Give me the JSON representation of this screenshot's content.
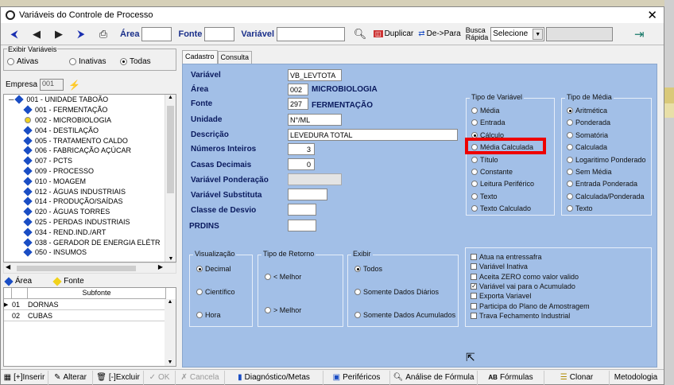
{
  "window": {
    "title": "Variáveis do Controle de Processo"
  },
  "toolbar": {
    "area_label": "Área",
    "fonte_label": "Fonte",
    "variavel_label": "Variável",
    "duplicar_label": "Duplicar",
    "de_para_label": "De->Para",
    "busca_label_1": "Busca",
    "busca_label_2": "Rápida",
    "busca_select": "Selecione"
  },
  "filter": {
    "legend": "Exibir Variáveis",
    "ativas": "Ativas",
    "inativas": "Inativas",
    "todas": "Todas",
    "selected": "Todas"
  },
  "empresa": {
    "label": "Empresa",
    "value": "001"
  },
  "tree": {
    "root": "001 - UNIDADE TABOÃO",
    "items": [
      "001 - FERMENTAÇÃO",
      "002 - MICROBIOLOGIA",
      "004 - DESTILAÇÃO",
      "005 - TRATAMENTO CALDO",
      "006 - FABRICAÇÃO AÇÚCAR",
      "007 - PCTS",
      "009 - PROCESSO",
      "010 - MOAGEM",
      "012 - ÁGUAS INDUSTRIAIS",
      "014 - PRODUÇÃO/SAÍDAS",
      "020 - ÁGUAS TORRES",
      "025 - PERDAS INDUSTRIAIS",
      "034 - REND.IND./ART",
      "038 - GERADOR DE ENERGIA ELÉTR",
      "050 - INSUMOS"
    ]
  },
  "legend": {
    "area": "Área",
    "fonte": "Fonte"
  },
  "subfonte": {
    "header": "Subfonte",
    "rows": [
      {
        "code": "01",
        "name": "DORNAS"
      },
      {
        "code": "02",
        "name": "CUBAS"
      }
    ]
  },
  "tabs": [
    "Cadastro",
    "Consulta"
  ],
  "form": {
    "variavel": {
      "label": "Variável",
      "value": "VB_LEVTOTA"
    },
    "area": {
      "label": "Área",
      "code": "002",
      "name": "MICROBIOLOGIA"
    },
    "fonte": {
      "label": "Fonte",
      "code": "297",
      "name": "FERMENTAÇÃO"
    },
    "unidade": {
      "label": "Unidade",
      "value": "N°/ML"
    },
    "descricao": {
      "label": "Descrição",
      "value": "LEVEDURA TOTAL"
    },
    "numeros_inteiros": {
      "label": "Números Inteiros",
      "value": "3"
    },
    "casas_decimais": {
      "label": "Casas Decimais",
      "value": "0"
    },
    "variavel_ponderacao": {
      "label": "Variável  Ponderação",
      "value": ""
    },
    "variavel_substituta": {
      "label": "Variável  Substituta",
      "value": ""
    },
    "classe_desvio": {
      "label": "Classe de Desvio",
      "value": ""
    },
    "prdins": {
      "label": "PRDINS",
      "value": ""
    }
  },
  "tipo_variavel": {
    "legend": "Tipo de Variável",
    "options": [
      "Média",
      "Entrada",
      "Cálculo",
      "Média Calculada",
      "Título",
      "Constante",
      "Leitura Periférico",
      "Texto",
      "Texto Calculado"
    ],
    "selected": "Cálculo"
  },
  "tipo_media": {
    "legend": "Tipo de Média",
    "options": [
      "Aritmética",
      "Ponderada",
      "Somatória",
      "Calculada",
      "Logaritimo Ponderado",
      "Sem Média",
      "Entrada Ponderada",
      "Calculada/Ponderada",
      "Texto"
    ],
    "selected": "Aritmética"
  },
  "visualizacao": {
    "legend": "Visualização",
    "options": [
      "Decimal",
      "Científico",
      "Hora"
    ],
    "selected": "Decimal"
  },
  "tipo_retorno": {
    "legend": "Tipo de Retorno",
    "options": [
      "< Melhor",
      "> Melhor"
    ]
  },
  "exibir": {
    "legend": "Exibir",
    "options": [
      "Todos",
      "Somente Dados Diários",
      "Somente Dados Acumulados"
    ],
    "selected": "Todos"
  },
  "checks": [
    {
      "label": "Atua na entressafra",
      "checked": false
    },
    {
      "label": "Variável Inativa",
      "checked": false
    },
    {
      "label": "Aceita ZERO como valor valido",
      "checked": false
    },
    {
      "label": "Variável vai para o Acumulado",
      "checked": true
    },
    {
      "label": "Exporta Variavel",
      "checked": false
    },
    {
      "label": "Participa do Plano de Amostragem",
      "checked": false
    },
    {
      "label": "Trava Fechamento Industrial",
      "checked": false
    }
  ],
  "bottom": {
    "inserir": "[+]Inserir",
    "alterar": "Alterar",
    "excluir": "[-]Excluir",
    "ok": "OK",
    "cancela": "Cancela",
    "diagnostico": "Diagnóstico/Metas",
    "perifericos": "Periféricos",
    "analise": "Análise de Fórmula",
    "formulas": "Fórmulas",
    "clonar": "Clonar",
    "metodologia": "Metodologia",
    "ab_icon_text": "AB"
  }
}
